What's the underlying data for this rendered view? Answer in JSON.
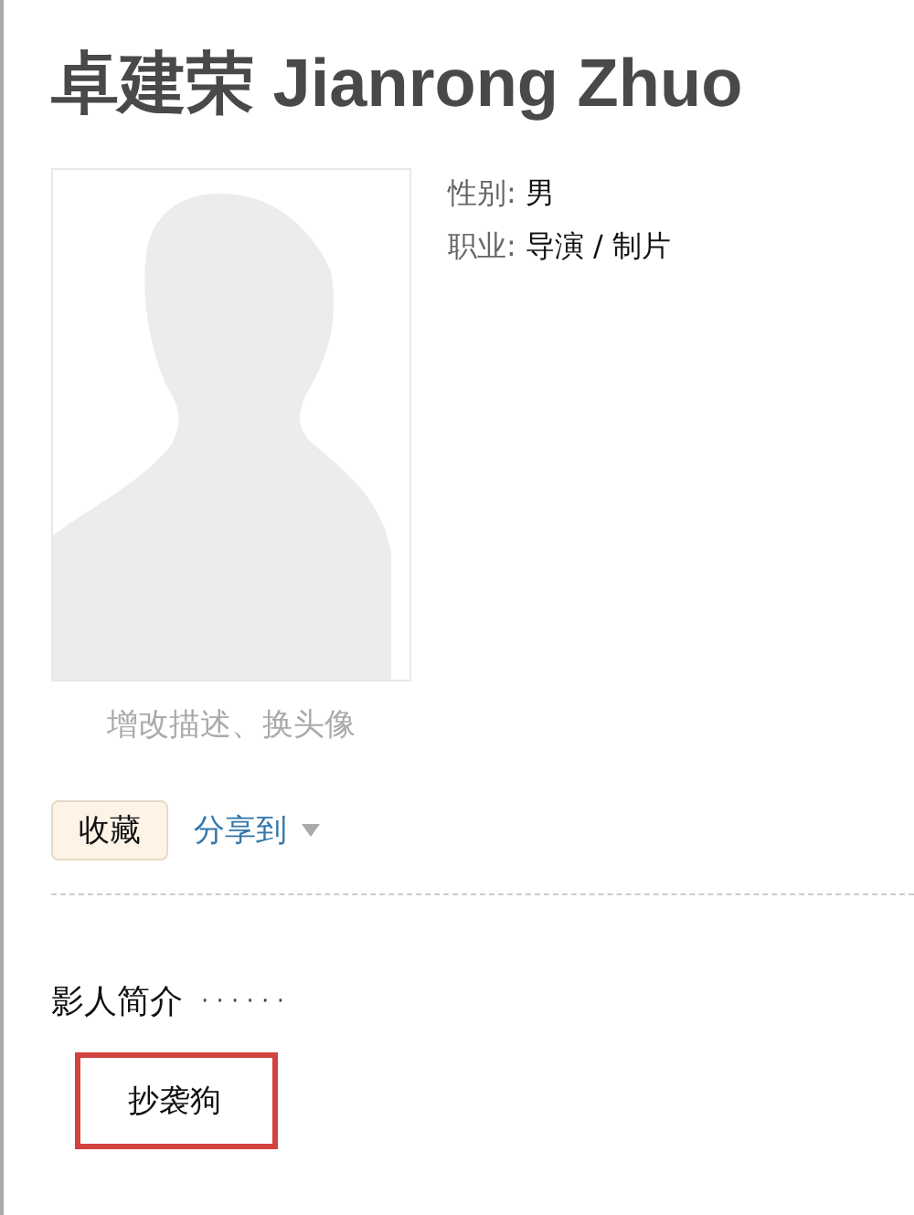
{
  "title": "卓建荣 Jianrong Zhuo",
  "photo": {
    "caption": "增改描述、换头像"
  },
  "info": [
    {
      "label": "性别:",
      "value": "男"
    },
    {
      "label": "职业:",
      "value": "导演 / 制片"
    }
  ],
  "actions": {
    "collect_button": "收藏",
    "share_link": "分享到"
  },
  "section": {
    "heading": "影人简介",
    "dots": "· · · · · ·",
    "highlighted_text": "抄袭狗"
  }
}
